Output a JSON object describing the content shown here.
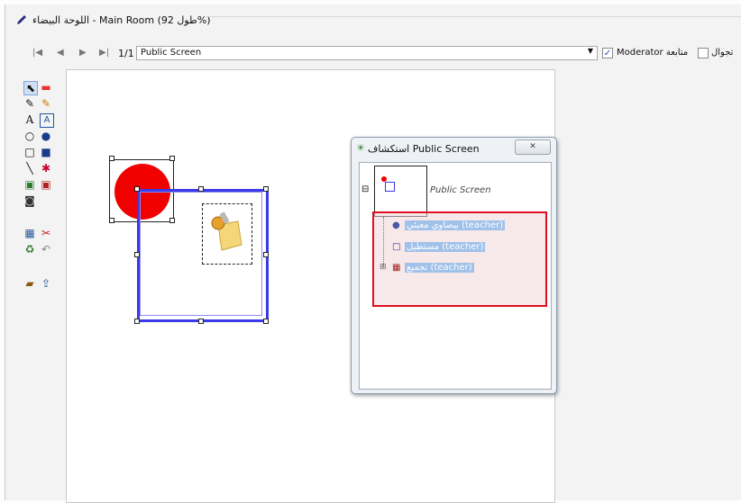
{
  "window": {
    "title": "اللوحة البيضاء - Main Room (طول 92%)"
  },
  "nav": {
    "page": "1/1",
    "screen": "Public Screen",
    "moderator_label": "Moderator متابعة",
    "moderator_checked": true,
    "tour_label": "تجوال",
    "tour_checked": false
  },
  "tools": [
    "select-icon",
    "eraser-icon",
    "pen-icon",
    "highlighter-icon",
    "text-icon",
    "text-box-icon",
    "circle-outline-icon",
    "circle-filled-icon",
    "square-outline-icon",
    "square-filled-icon",
    "line-icon",
    "magic-wand-icon",
    "image-icon",
    "image-insert-icon",
    "camera-icon",
    "snapshot-icon",
    "delete-icon",
    "recycle-icon",
    "undo-icon",
    "folder-icon",
    "export-icon"
  ],
  "dialog": {
    "title": "استكشاف Public Screen",
    "root": "Public Screen",
    "items": [
      "بيضاوي معبئي (teacher)",
      "مستطيل (teacher)",
      "تجميع (teacher)"
    ]
  },
  "colors": {
    "accent_circle": "#f10000",
    "selection": "#3a3ae8",
    "highlight_box": "#e01020"
  }
}
